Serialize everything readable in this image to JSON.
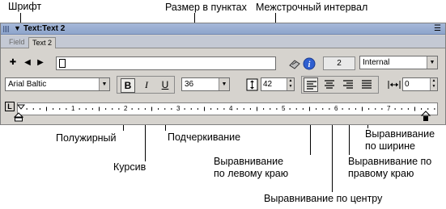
{
  "annotations": {
    "font": "Шрифт",
    "size_points": "Размер в пунктах",
    "line_spacing": "Межстрочный интервал",
    "bold": "Полужирный",
    "italic": "Курсив",
    "underline": "Подчеркивание",
    "align_left": "Выравнивание по левому краю",
    "align_center": "Выравнивание по центру",
    "align_right": "Выравнивание по правому краю",
    "justify": "Выравнивание по ширине"
  },
  "panel": {
    "title": "Text:Text 2",
    "tabs": [
      "Field",
      "Text 2"
    ],
    "active_tab": "Text 2"
  },
  "toolbar": {
    "textfield_value": "",
    "number_value": "2",
    "layer_select": "Internal",
    "font_select": "Arial Baltic",
    "size_select": "36",
    "bold_label": "B",
    "italic_label": "I",
    "underline_label": "U",
    "line_spacing_value": "42",
    "indent_value": "0"
  },
  "ruler": {
    "numbers": [
      "1",
      "2",
      "3",
      "4",
      "5",
      "6",
      "7"
    ]
  },
  "colors": {
    "titlebar": "#8ea5cc",
    "panel_bg": "#d6d3ce",
    "info_icon": "#2f5fd0"
  },
  "icons": {
    "grip": "grip-icon",
    "panel_menu": "panel-menu-icon",
    "first": "first-icon",
    "prev": "prev-icon",
    "next": "next-icon",
    "frame": "frame-icon",
    "script": "script-icon",
    "info": "info-icon",
    "line_spacing": "line-spacing-icon",
    "indent": "indent-icon"
  }
}
